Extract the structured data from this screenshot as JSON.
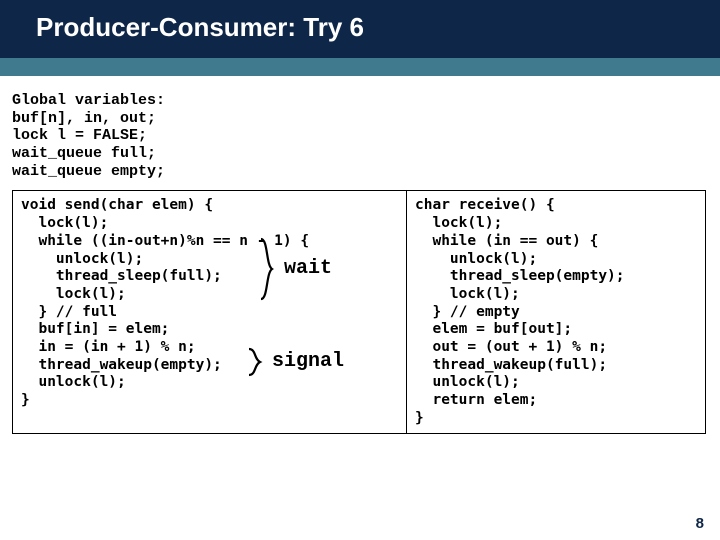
{
  "title": "Producer-Consumer: Try 6",
  "globals": "Global variables:\nbuf[n], in, out;\nlock l = FALSE;\nwait_queue full;\nwait_queue empty;",
  "send_code": "void send(char elem) {\n  lock(l);\n  while ((in-out+n)%n == n - 1) {\n    unlock(l);\n    thread_sleep(full);\n    lock(l);\n  } // full\n  buf[in] = elem;\n  in = (in + 1) % n;\n  thread_wakeup(empty);\n  unlock(l);\n}",
  "receive_code": "char receive() {\n  lock(l);\n  while (in == out) {\n    unlock(l);\n    thread_sleep(empty);\n    lock(l);\n  } // empty\n  elem = buf[out];\n  out = (out + 1) % n;\n  thread_wakeup(full);\n  unlock(l);\n  return elem;\n}",
  "annot": {
    "wait": "wait",
    "signal": "signal"
  },
  "page_number": "8"
}
